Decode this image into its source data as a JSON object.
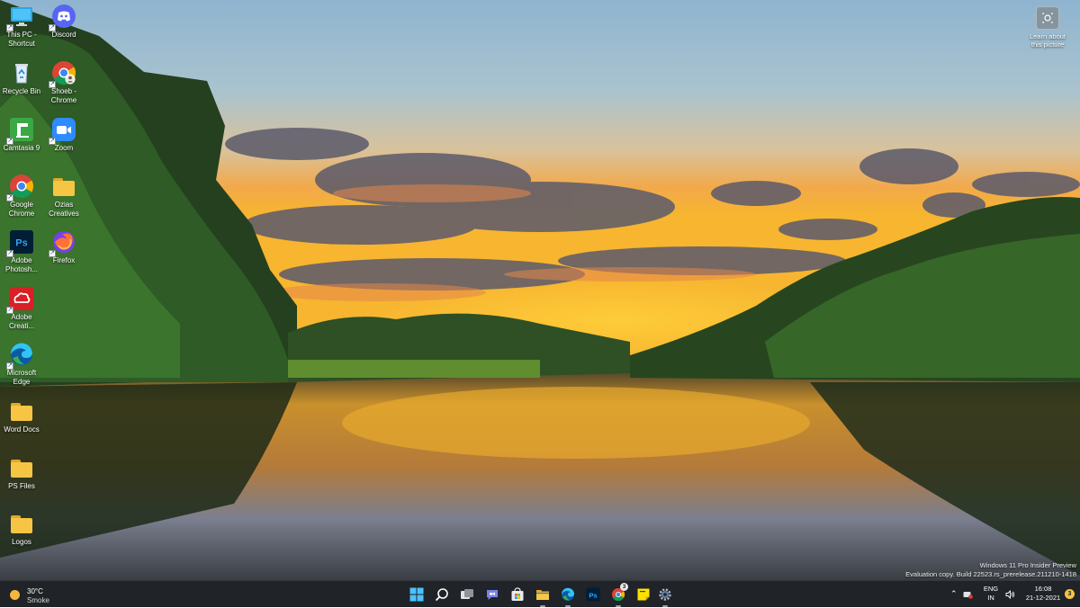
{
  "desktop": {
    "icons": [
      {
        "label": "This PC - Shortcut",
        "icon": "monitor-icon"
      },
      {
        "label": "Discord",
        "icon": "discord-icon"
      },
      {
        "label": "Recycle Bin",
        "icon": "recycle-bin-icon"
      },
      {
        "label": "Shoeb - Chrome",
        "icon": "chrome-profile-icon"
      },
      {
        "label": "Camtasia 9",
        "icon": "camtasia-icon"
      },
      {
        "label": "Zoom",
        "icon": "zoom-icon"
      },
      {
        "label": "Google Chrome",
        "icon": "chrome-icon"
      },
      {
        "label": "Ozias Creatives",
        "icon": "folder-icon"
      },
      {
        "label": "Adobe Photosh...",
        "icon": "photoshop-icon"
      },
      {
        "label": "Firefox",
        "icon": "firefox-icon"
      },
      {
        "label": "Adobe Creati...",
        "icon": "adobe-creative-cloud-icon"
      },
      {
        "label": "Microsoft Edge",
        "icon": "edge-icon"
      },
      {
        "label": "Word Docs",
        "icon": "folder-icon"
      },
      {
        "label": "PS Files",
        "icon": "folder-icon"
      },
      {
        "label": "Logos",
        "icon": "folder-icon"
      }
    ],
    "learn_about_picture": {
      "label": "Learn about this picture",
      "icon": "camera-lens-icon"
    }
  },
  "watermark": {
    "line1": "Windows 11 Pro Insider Preview",
    "line2": "Evaluation copy. Build 22523.rs_prerelease.211210-1418"
  },
  "taskbar": {
    "weather": {
      "temperature": "30°C",
      "condition": "Smoke",
      "icon": "sun-icon"
    },
    "apps": [
      {
        "name": "Start",
        "icon": "windows-start-icon"
      },
      {
        "name": "Search",
        "icon": "search-icon"
      },
      {
        "name": "Task View",
        "icon": "task-view-icon"
      },
      {
        "name": "Chat",
        "icon": "chat-icon"
      },
      {
        "name": "Microsoft Store",
        "icon": "store-icon"
      },
      {
        "name": "File Explorer",
        "icon": "file-explorer-icon"
      },
      {
        "name": "Microsoft Edge",
        "icon": "edge-icon"
      },
      {
        "name": "Adobe Photoshop",
        "icon": "photoshop-icon"
      },
      {
        "name": "Google Chrome",
        "icon": "chrome-icon",
        "badge": "3"
      },
      {
        "name": "Sticky Notes",
        "icon": "sticky-notes-icon"
      },
      {
        "name": "Settings",
        "icon": "gear-icon"
      }
    ],
    "tray": {
      "language_top": "ENG",
      "language_bottom": "IN",
      "time": "16:08",
      "date": "21-12-2021",
      "notification_count": "3"
    }
  },
  "colors": {
    "taskbar_bg": "#202327",
    "accent_blue": "#0078d4",
    "folder_yellow": "#f6c544"
  }
}
